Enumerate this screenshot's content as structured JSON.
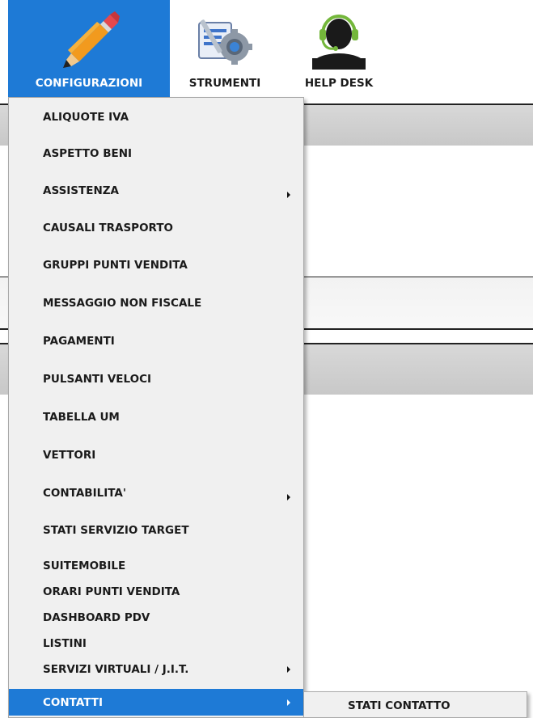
{
  "ribbon": {
    "configurazioni_label": "CONFIGURAZIONI",
    "strumenti_label": "STRUMENTI",
    "helpdesk_label": "HELP DESK",
    "accent_color": "#1e7ad6"
  },
  "menu": {
    "items": [
      {
        "label": "ALIQUOTE IVA"
      },
      {
        "label": "ASPETTO BENI"
      },
      {
        "label": "ASSISTENZA",
        "submenu": true
      },
      {
        "label": "CAUSALI TRASPORTO"
      },
      {
        "label": "GRUPPI PUNTI VENDITA"
      },
      {
        "label": "MESSAGGIO NON FISCALE"
      },
      {
        "label": "PAGAMENTI"
      },
      {
        "label": "PULSANTI VELOCI"
      },
      {
        "label": "TABELLA UM"
      },
      {
        "label": "VETTORI"
      },
      {
        "label": "CONTABILITA'",
        "submenu": true
      },
      {
        "label": "STATI SERVIZIO TARGET"
      },
      {
        "label": "SUITEMOBILE"
      },
      {
        "label": "ORARI PUNTI VENDITA"
      },
      {
        "label": "DASHBOARD PDV"
      },
      {
        "label": "LISTINI"
      },
      {
        "label": "SERVIZI VIRTUALI / J.I.T.",
        "submenu": true
      },
      {
        "label": "CONTATTI",
        "submenu": true,
        "active": true
      }
    ]
  },
  "submenu": {
    "items": [
      {
        "label": "STATI CONTATTO"
      }
    ]
  },
  "icons": {
    "configurazioni": "pencil-icon",
    "strumenti": "tools-gear-icon",
    "helpdesk": "headset-user-icon"
  }
}
